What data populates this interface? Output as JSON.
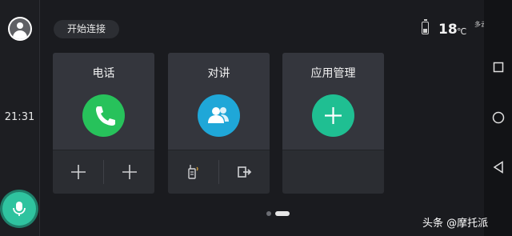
{
  "sidebar": {
    "avatar_icon": "user-avatar-icon",
    "time": "21:31",
    "mic_icon": "microphone-icon"
  },
  "header": {
    "connect_label": "开始连接"
  },
  "status": {
    "battery_icon": "battery-icon",
    "temperature": "18",
    "temperature_unit": "℃",
    "weather": "多云"
  },
  "cards": [
    {
      "title": "电话",
      "icon": "phone-icon",
      "color": "#27c25b",
      "bottom": [
        "plus-icon",
        "plus-icon"
      ]
    },
    {
      "title": "对讲",
      "icon": "contacts-icon",
      "color": "#1fa7d8",
      "bottom": [
        "walkie-talkie-icon",
        "exit-icon"
      ]
    },
    {
      "title": "应用管理",
      "icon": "plus-icon",
      "color": "#1fbf92",
      "bottom": []
    }
  ],
  "pager": {
    "pages": 2,
    "active": 2
  },
  "nav": [
    "recent-apps-icon",
    "home-icon",
    "back-icon"
  ],
  "watermark": "头条 @摩托派"
}
